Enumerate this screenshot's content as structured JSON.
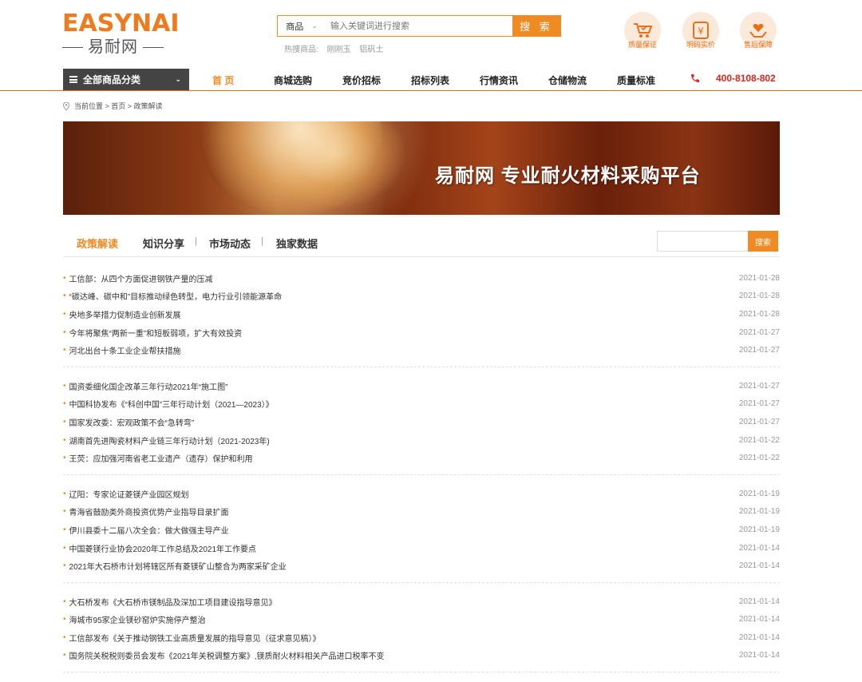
{
  "logo": {
    "en": "EASYNAI",
    "cn": "易耐网"
  },
  "search": {
    "category": "商品",
    "placeholder": "输入关键词进行搜索",
    "button": "搜 索",
    "hot_label": "热搜商品:",
    "hot_items": [
      "刚刚玉",
      "铝矾土"
    ]
  },
  "badges": [
    {
      "label": "质量保证",
      "icon": "cart-check-icon"
    },
    {
      "label": "明码实价",
      "icon": "yen-icon"
    },
    {
      "label": "售后保障",
      "icon": "hand-heart-icon"
    }
  ],
  "nav": {
    "all_categories": "全部商品分类",
    "items": [
      "首 页",
      "商城选购",
      "竞价招标",
      "招标列表",
      "行情资讯",
      "仓储物流",
      "质量标准"
    ],
    "phone": "400-8108-802"
  },
  "breadcrumb": "当前位置 > 首页 > 政策解读",
  "banner": {
    "text": "易耐网 专业耐火材料采购平台"
  },
  "tabs": [
    "政策解读",
    "知识分享",
    "市场动态",
    "独家数据"
  ],
  "side_search": {
    "button": "搜索"
  },
  "colors": {
    "accent": "#f08a22",
    "nav_dark": "#444444",
    "phone_red": "#d4281e"
  },
  "news_groups": [
    [
      {
        "title": "工信部：从四个方面促进钢铁产量的压减",
        "date": "2021-01-28"
      },
      {
        "title": "“碳达峰、碳中和”目标推动绿色转型，电力行业引领能源革命",
        "date": "2021-01-28"
      },
      {
        "title": "央地多举措力促制造业创新发展",
        "date": "2021-01-28"
      },
      {
        "title": "今年将聚焦“两新一重”和短板弱项，扩大有效投资",
        "date": "2021-01-27"
      },
      {
        "title": "河北出台十条工业企业帮扶措施",
        "date": "2021-01-27"
      }
    ],
    [
      {
        "title": "国资委细化国企改革三年行动2021年“施工图”",
        "date": "2021-01-27"
      },
      {
        "title": "中国科协发布《“科创中国”三年行动计划（2021—2023）》",
        "date": "2021-01-27"
      },
      {
        "title": "国家发改委：宏观政策不会“急转弯”",
        "date": "2021-01-27"
      },
      {
        "title": "湖南首先进陶瓷材料产业链三年行动计划（2021-2023年)",
        "date": "2021-01-22"
      },
      {
        "title": "王荧：应加强河南省老工业遗产（遗存）保护和利用",
        "date": "2021-01-22"
      }
    ],
    [
      {
        "title": "辽阳：专家论证菱镁产业园区规划",
        "date": "2021-01-19"
      },
      {
        "title": "青海省鼓励类外商投资优势产业指导目录扩面",
        "date": "2021-01-19"
      },
      {
        "title": "伊川县委十二届八次全会：做大做强主导产业",
        "date": "2021-01-19"
      },
      {
        "title": "中国菱镁行业协会2020年工作总结及2021年工作要点",
        "date": "2021-01-14"
      },
      {
        "title": "2021年大石桥市计划将辖区所有菱镁矿山整合为两家采矿企业",
        "date": "2021-01-14"
      }
    ],
    [
      {
        "title": "大石桥发布《大石桥市镁制品及深加工项目建设指导意见》",
        "date": "2021-01-14"
      },
      {
        "title": "海城市95家企业镁砂窑炉实施停产整治",
        "date": "2021-01-14"
      },
      {
        "title": "工信部发布《关于推动钢铁工业高质量发展的指导意见（征求意见稿）》",
        "date": "2021-01-14"
      },
      {
        "title": "国务院关税税则委员会发布《2021年关税调整方案》,镁质耐火材料相关产品进口税率不变",
        "date": "2021-01-14"
      }
    ]
  ]
}
